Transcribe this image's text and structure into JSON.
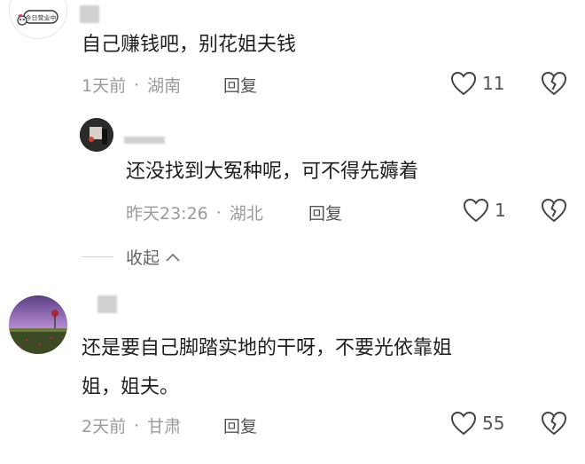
{
  "comments": [
    {
      "text": "自己赚钱吧，别花姐夫钱",
      "time": "1天前",
      "location": "湖南",
      "reply_label": "回复",
      "likes": "11",
      "avatar_sticker": "今日营业中"
    },
    {
      "text": "还没找到大冤种呢，可不得先薅着",
      "time": "昨天23:26",
      "location": "湖北",
      "reply_label": "回复",
      "likes": "1"
    },
    {
      "text_line1": "还是要自己脚踏实地的干呀，不要光依靠姐",
      "text_line2": "姐，姐夫。",
      "time": "2天前",
      "location": "甘肃",
      "reply_label": "回复",
      "likes": "55"
    }
  ],
  "collapse_label": "收起",
  "separator": "·",
  "colors": {
    "meta": "#9a9a9a",
    "text": "#1f1f1f",
    "icon": "#444444"
  },
  "icons": {
    "like": "heart-outline-icon",
    "dislike": "broken-heart-icon",
    "collapse": "chevron-up-icon"
  }
}
